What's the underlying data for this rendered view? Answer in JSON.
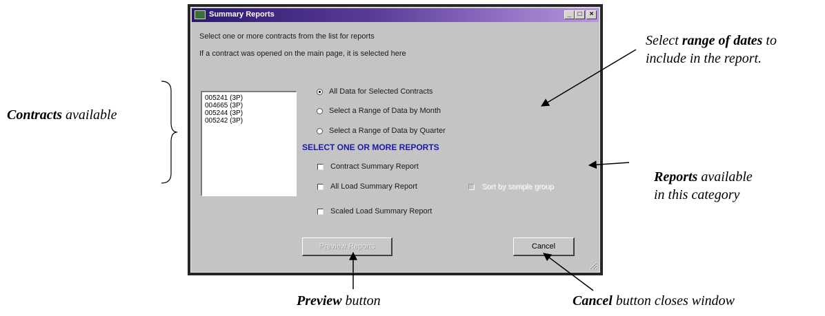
{
  "window": {
    "title": "Summary Reports",
    "minimize_glyph": "_",
    "maximize_glyph": "□",
    "close_glyph": "×"
  },
  "instructions": {
    "line1": "Select one or more contracts from the list for reports",
    "line2": "If a contract was opened on the main page, it is selected here"
  },
  "contracts": [
    "005241 (3P)",
    "004665 (3P)",
    "005244 (3P)",
    "005242 (3P)"
  ],
  "date_range_options": [
    {
      "label": "All Data for Selected Contracts",
      "selected": true
    },
    {
      "label": "Select a Range of Data by Month",
      "selected": false
    },
    {
      "label": "Select a Range of Data by Quarter",
      "selected": false
    }
  ],
  "reports_heading": "SELECT ONE OR MORE REPORTS",
  "reports": [
    {
      "label": "Contract Summary Report",
      "checked": false
    },
    {
      "label": "All Load Summary Report",
      "checked": false
    },
    {
      "label": "Scaled Load Summary Report",
      "checked": false
    }
  ],
  "sort_by_sample_group": {
    "label": "Sort by sample group",
    "checked": false,
    "enabled": false
  },
  "buttons": {
    "preview": "Preview Reports",
    "cancel": "Cancel"
  },
  "annotations": {
    "contracts_bold": "Contracts",
    "contracts_rest": " available",
    "dates_pre": "Select ",
    "dates_bold": "range of dates",
    "dates_post": " to",
    "dates_line2": "include in the report.",
    "reports_bold": "Reports",
    "reports_rest": " available",
    "reports_line2": "in this category",
    "preview_bold": "Preview",
    "preview_rest": " button",
    "cancel_bold": "Cancel",
    "cancel_rest": " button closes window"
  },
  "colors": {
    "title_gradient_start": "#2d1a6b",
    "title_gradient_end": "#b897e0",
    "section_heading": "#1a1aa8",
    "dialog_face": "#c4c4c4"
  }
}
